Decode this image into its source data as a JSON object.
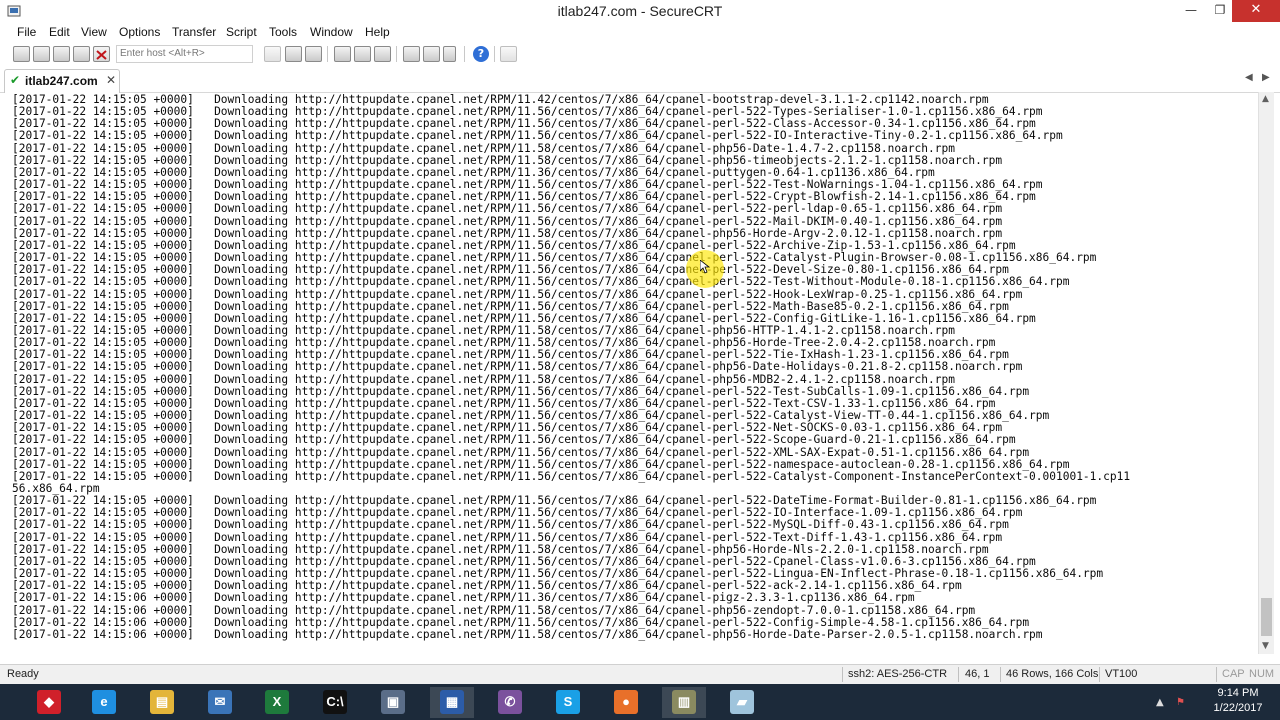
{
  "window": {
    "title": "itlab247.com - SecureCRT",
    "minimize": "—",
    "maximize": "❐",
    "close": "✕"
  },
  "menu": [
    "File",
    "Edit",
    "View",
    "Options",
    "Transfer",
    "Script",
    "Tools",
    "Window",
    "Help"
  ],
  "toolbar": {
    "host_placeholder": "Enter host <Alt+R>",
    "help_glyph": "?"
  },
  "tab": {
    "label": "itlab247.com",
    "close": "✕",
    "check": "✔",
    "nav_prev": "◀",
    "nav_next": "▶"
  },
  "terminal": {
    "lines": [
      "[2017-01-22 14:15:05 +0000]   Downloading http://httpupdate.cpanel.net/RPM/11.42/centos/7/x86_64/cpanel-bootstrap-devel-3.1.1-2.cp1142.noarch.rpm",
      "[2017-01-22 14:15:05 +0000]   Downloading http://httpupdate.cpanel.net/RPM/11.56/centos/7/x86_64/cpanel-perl-522-Types-Serialiser-1.0-1.cp1156.x86_64.rpm",
      "[2017-01-22 14:15:05 +0000]   Downloading http://httpupdate.cpanel.net/RPM/11.56/centos/7/x86_64/cpanel-perl-522-Class-Accessor-0.34-1.cp1156.x86_64.rpm",
      "[2017-01-22 14:15:05 +0000]   Downloading http://httpupdate.cpanel.net/RPM/11.56/centos/7/x86_64/cpanel-perl-522-IO-Interactive-Tiny-0.2-1.cp1156.x86_64.rpm",
      "[2017-01-22 14:15:05 +0000]   Downloading http://httpupdate.cpanel.net/RPM/11.58/centos/7/x86_64/cpanel-php56-Date-1.4.7-2.cp1158.noarch.rpm",
      "[2017-01-22 14:15:05 +0000]   Downloading http://httpupdate.cpanel.net/RPM/11.58/centos/7/x86_64/cpanel-php56-timeobjects-2.1.2-1.cp1158.noarch.rpm",
      "[2017-01-22 14:15:05 +0000]   Downloading http://httpupdate.cpanel.net/RPM/11.36/centos/7/x86_64/cpanel-puttygen-0.64-1.cp1136.x86_64.rpm",
      "[2017-01-22 14:15:05 +0000]   Downloading http://httpupdate.cpanel.net/RPM/11.56/centos/7/x86_64/cpanel-perl-522-Test-NoWarnings-1.04-1.cp1156.x86_64.rpm",
      "[2017-01-22 14:15:05 +0000]   Downloading http://httpupdate.cpanel.net/RPM/11.56/centos/7/x86_64/cpanel-perl-522-Crypt-Blowfish-2.14-1.cp1156.x86_64.rpm",
      "[2017-01-22 14:15:05 +0000]   Downloading http://httpupdate.cpanel.net/RPM/11.56/centos/7/x86_64/cpanel-perl-522-perl-ldap-0.65-1.cp1156.x86_64.rpm",
      "[2017-01-22 14:15:05 +0000]   Downloading http://httpupdate.cpanel.net/RPM/11.56/centos/7/x86_64/cpanel-perl-522-Mail-DKIM-0.40-1.cp1156.x86_64.rpm",
      "[2017-01-22 14:15:05 +0000]   Downloading http://httpupdate.cpanel.net/RPM/11.58/centos/7/x86_64/cpanel-php56-Horde-Argv-2.0.12-1.cp1158.noarch.rpm",
      "[2017-01-22 14:15:05 +0000]   Downloading http://httpupdate.cpanel.net/RPM/11.56/centos/7/x86_64/cpanel-perl-522-Archive-Zip-1.53-1.cp1156.x86_64.rpm",
      "[2017-01-22 14:15:05 +0000]   Downloading http://httpupdate.cpanel.net/RPM/11.56/centos/7/x86_64/cpanel-perl-522-Catalyst-Plugin-Browser-0.08-1.cp1156.x86_64.rpm",
      "[2017-01-22 14:15:05 +0000]   Downloading http://httpupdate.cpanel.net/RPM/11.56/centos/7/x86_64/cpanel-perl-522-Devel-Size-0.80-1.cp1156.x86_64.rpm",
      "[2017-01-22 14:15:05 +0000]   Downloading http://httpupdate.cpanel.net/RPM/11.56/centos/7/x86_64/cpanel-perl-522-Test-Without-Module-0.18-1.cp1156.x86_64.rpm",
      "[2017-01-22 14:15:05 +0000]   Downloading http://httpupdate.cpanel.net/RPM/11.56/centos/7/x86_64/cpanel-perl-522-Hook-LexWrap-0.25-1.cp1156.x86_64.rpm",
      "[2017-01-22 14:15:05 +0000]   Downloading http://httpupdate.cpanel.net/RPM/11.56/centos/7/x86_64/cpanel-perl-522-Math-Base85-0.2-1.cp1156.x86_64.rpm",
      "[2017-01-22 14:15:05 +0000]   Downloading http://httpupdate.cpanel.net/RPM/11.56/centos/7/x86_64/cpanel-perl-522-Config-GitLike-1.16-1.cp1156.x86_64.rpm",
      "[2017-01-22 14:15:05 +0000]   Downloading http://httpupdate.cpanel.net/RPM/11.58/centos/7/x86_64/cpanel-php56-HTTP-1.4.1-2.cp1158.noarch.rpm",
      "[2017-01-22 14:15:05 +0000]   Downloading http://httpupdate.cpanel.net/RPM/11.58/centos/7/x86_64/cpanel-php56-Horde-Tree-2.0.4-2.cp1158.noarch.rpm",
      "[2017-01-22 14:15:05 +0000]   Downloading http://httpupdate.cpanel.net/RPM/11.56/centos/7/x86_64/cpanel-perl-522-Tie-IxHash-1.23-1.cp1156.x86_64.rpm",
      "[2017-01-22 14:15:05 +0000]   Downloading http://httpupdate.cpanel.net/RPM/11.58/centos/7/x86_64/cpanel-php56-Date-Holidays-0.21.8-2.cp1158.noarch.rpm",
      "[2017-01-22 14:15:05 +0000]   Downloading http://httpupdate.cpanel.net/RPM/11.58/centos/7/x86_64/cpanel-php56-MDB2-2.4.1-2.cp1158.noarch.rpm",
      "[2017-01-22 14:15:05 +0000]   Downloading http://httpupdate.cpanel.net/RPM/11.56/centos/7/x86_64/cpanel-perl-522-Test-SubCalls-1.09-1.cp1156.x86_64.rpm",
      "[2017-01-22 14:15:05 +0000]   Downloading http://httpupdate.cpanel.net/RPM/11.56/centos/7/x86_64/cpanel-perl-522-Text-CSV-1.33-1.cp1156.x86_64.rpm",
      "[2017-01-22 14:15:05 +0000]   Downloading http://httpupdate.cpanel.net/RPM/11.56/centos/7/x86_64/cpanel-perl-522-Catalyst-View-TT-0.44-1.cp1156.x86_64.rpm",
      "[2017-01-22 14:15:05 +0000]   Downloading http://httpupdate.cpanel.net/RPM/11.56/centos/7/x86_64/cpanel-perl-522-Net-SOCKS-0.03-1.cp1156.x86_64.rpm",
      "[2017-01-22 14:15:05 +0000]   Downloading http://httpupdate.cpanel.net/RPM/11.56/centos/7/x86_64/cpanel-perl-522-Scope-Guard-0.21-1.cp1156.x86_64.rpm",
      "[2017-01-22 14:15:05 +0000]   Downloading http://httpupdate.cpanel.net/RPM/11.56/centos/7/x86_64/cpanel-perl-522-XML-SAX-Expat-0.51-1.cp1156.x86_64.rpm",
      "[2017-01-22 14:15:05 +0000]   Downloading http://httpupdate.cpanel.net/RPM/11.56/centos/7/x86_64/cpanel-perl-522-namespace-autoclean-0.28-1.cp1156.x86_64.rpm",
      "[2017-01-22 14:15:05 +0000]   Downloading http://httpupdate.cpanel.net/RPM/11.56/centos/7/x86_64/cpanel-perl-522-Catalyst-Component-InstancePerContext-0.001001-1.cp11",
      "56.x86_64.rpm",
      "[2017-01-22 14:15:05 +0000]   Downloading http://httpupdate.cpanel.net/RPM/11.56/centos/7/x86_64/cpanel-perl-522-DateTime-Format-Builder-0.81-1.cp1156.x86_64.rpm",
      "[2017-01-22 14:15:05 +0000]   Downloading http://httpupdate.cpanel.net/RPM/11.56/centos/7/x86_64/cpanel-perl-522-IO-Interface-1.09-1.cp1156.x86_64.rpm",
      "[2017-01-22 14:15:05 +0000]   Downloading http://httpupdate.cpanel.net/RPM/11.56/centos/7/x86_64/cpanel-perl-522-MySQL-Diff-0.43-1.cp1156.x86_64.rpm",
      "[2017-01-22 14:15:05 +0000]   Downloading http://httpupdate.cpanel.net/RPM/11.56/centos/7/x86_64/cpanel-perl-522-Text-Diff-1.43-1.cp1156.x86_64.rpm",
      "[2017-01-22 14:15:05 +0000]   Downloading http://httpupdate.cpanel.net/RPM/11.58/centos/7/x86_64/cpanel-php56-Horde-Nls-2.2.0-1.cp1158.noarch.rpm",
      "[2017-01-22 14:15:05 +0000]   Downloading http://httpupdate.cpanel.net/RPM/11.56/centos/7/x86_64/cpanel-perl-522-Cpanel-Class-v1.0.6-3.cp1156.x86_64.rpm",
      "[2017-01-22 14:15:05 +0000]   Downloading http://httpupdate.cpanel.net/RPM/11.56/centos/7/x86_64/cpanel-perl-522-Lingua-EN-Inflect-Phrase-0.18-1.cp1156.x86_64.rpm",
      "[2017-01-22 14:15:05 +0000]   Downloading http://httpupdate.cpanel.net/RPM/11.56/centos/7/x86_64/cpanel-perl-522-ack-2.14-1.cp1156.x86_64.rpm",
      "[2017-01-22 14:15:06 +0000]   Downloading http://httpupdate.cpanel.net/RPM/11.36/centos/7/x86_64/cpanel-pigz-2.3.3-1.cp1136.x86_64.rpm",
      "[2017-01-22 14:15:06 +0000]   Downloading http://httpupdate.cpanel.net/RPM/11.58/centos/7/x86_64/cpanel-php56-zendopt-7.0.0-1.cp1158.x86_64.rpm",
      "[2017-01-22 14:15:06 +0000]   Downloading http://httpupdate.cpanel.net/RPM/11.56/centos/7/x86_64/cpanel-perl-522-Config-Simple-4.58-1.cp1156.x86_64.rpm",
      "[2017-01-22 14:15:06 +0000]   Downloading http://httpupdate.cpanel.net/RPM/11.58/centos/7/x86_64/cpanel-php56-Horde-Date-Parser-2.0.5-1.cp1158.noarch.rpm"
    ]
  },
  "statusbar": {
    "ready": "Ready",
    "cipher": "ssh2: AES-256-CTR",
    "cursor": "46,  1",
    "size": "46 Rows, 166 Cols",
    "emulation": "VT100",
    "cap": "CAP",
    "num": "NUM"
  },
  "taskbar": {
    "time": "9:14 PM",
    "date": "1/22/2017",
    "apps": [
      {
        "name": "red-app-icon",
        "color": "#d0202a",
        "glyph": "◆"
      },
      {
        "name": "internet-explorer-icon",
        "color": "#1f8fe0",
        "glyph": "e"
      },
      {
        "name": "file-explorer-icon",
        "color": "#e3b53a",
        "glyph": "▤"
      },
      {
        "name": "thunderbird-icon",
        "color": "#3a74b8",
        "glyph": "✉"
      },
      {
        "name": "excel-icon",
        "color": "#1e7a3c",
        "glyph": "X"
      },
      {
        "name": "command-prompt-icon",
        "color": "#111111",
        "glyph": "C:\\"
      },
      {
        "name": "network-app-icon",
        "color": "#5a6d88",
        "glyph": "▣"
      },
      {
        "name": "remote-desktop-icon",
        "color": "#2c5ca8",
        "glyph": "▦"
      },
      {
        "name": "viber-icon",
        "color": "#7b519d",
        "glyph": "✆"
      },
      {
        "name": "skype-icon",
        "color": "#1aa0e6",
        "glyph": "S"
      },
      {
        "name": "firefox-icon",
        "color": "#e8702a",
        "glyph": "●"
      },
      {
        "name": "securecrt-icon",
        "color": "#8a8a60",
        "glyph": "▥"
      },
      {
        "name": "note-app-icon",
        "color": "#9fc4dc",
        "glyph": "▰"
      }
    ],
    "tray_up": "▲",
    "tray_flag": "⚑"
  },
  "colors": {
    "window_bg": "#ffffff",
    "taskbar_bg": "#1c2a3a",
    "close_button": "#c7312d",
    "highlight": "#ffe600"
  }
}
